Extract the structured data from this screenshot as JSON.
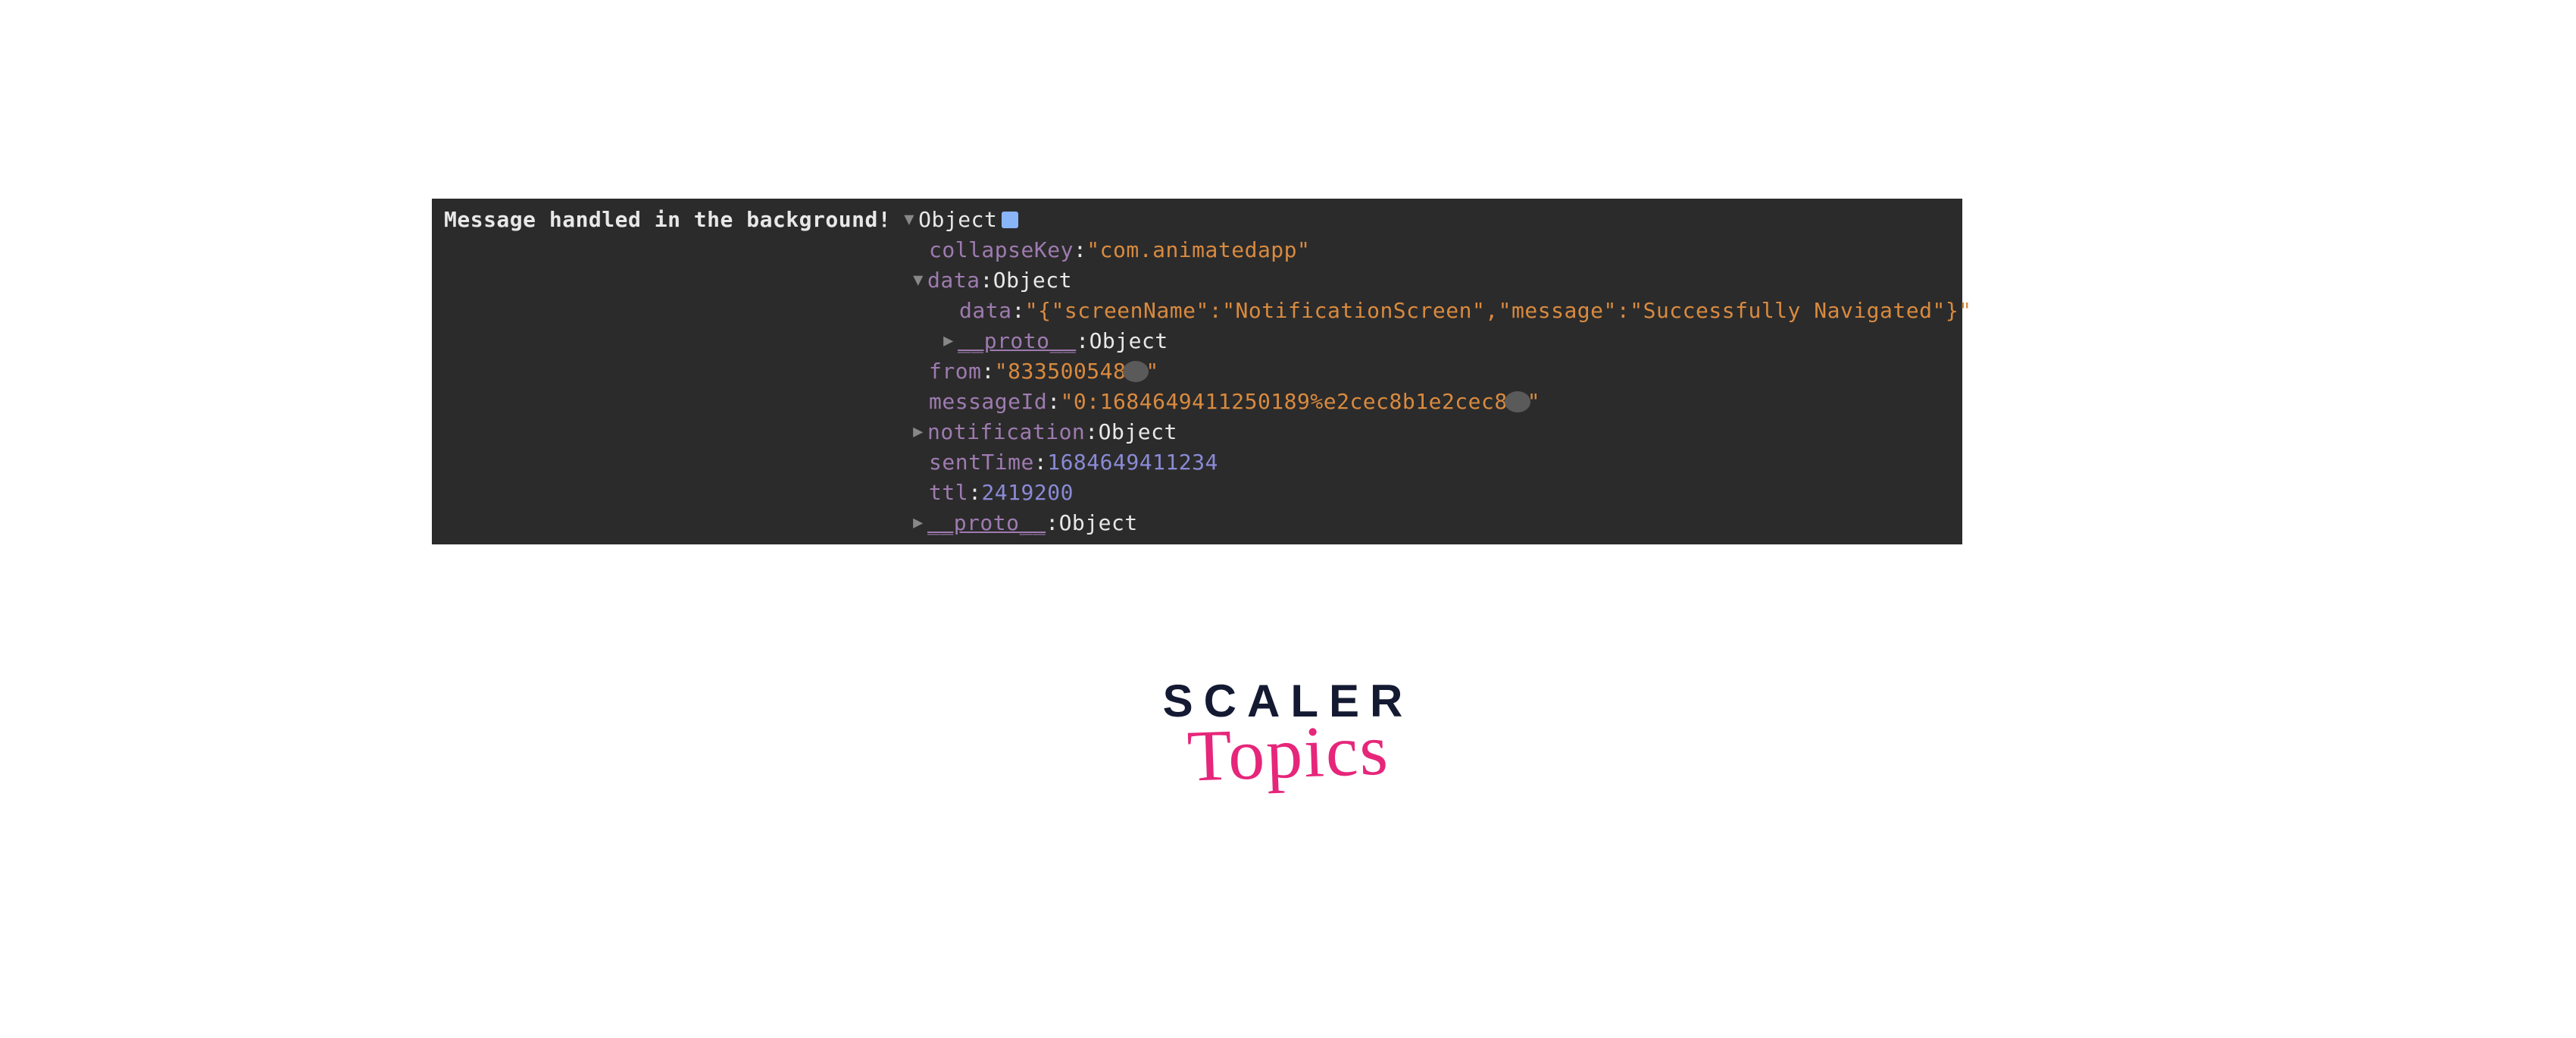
{
  "console": {
    "leadText": "Message handled in the background!",
    "root": {
      "typeLabel": "Object"
    },
    "lines": {
      "collapseKey": {
        "key": "collapseKey",
        "value": "\"com.animatedapp\""
      },
      "dataOuter": {
        "key": "data",
        "typeLabel": "Object"
      },
      "dataInner": {
        "key": "data",
        "value": "\"{\"screenName\":\"NotificationScreen\",\"message\":\"Successfully Navigated\"}\""
      },
      "protoInner": {
        "key": "__proto__",
        "typeLabel": "Object"
      },
      "from": {
        "key": "from",
        "valuePrefix": "\"833500548",
        "valueSuffix": "\""
      },
      "messageId": {
        "key": "messageId",
        "valuePrefix": "\"0:1684649411250189%e2cec8b1e2cec8",
        "valueSuffix": "\""
      },
      "notification": {
        "key": "notification",
        "typeLabel": "Object"
      },
      "sentTime": {
        "key": "sentTime",
        "value": "1684649411234"
      },
      "ttl": {
        "key": "ttl",
        "value": "2419200"
      },
      "protoOuter": {
        "key": "__proto__",
        "typeLabel": "Object"
      }
    }
  },
  "logo": {
    "line1": "SCALER",
    "line2": "Topics"
  }
}
